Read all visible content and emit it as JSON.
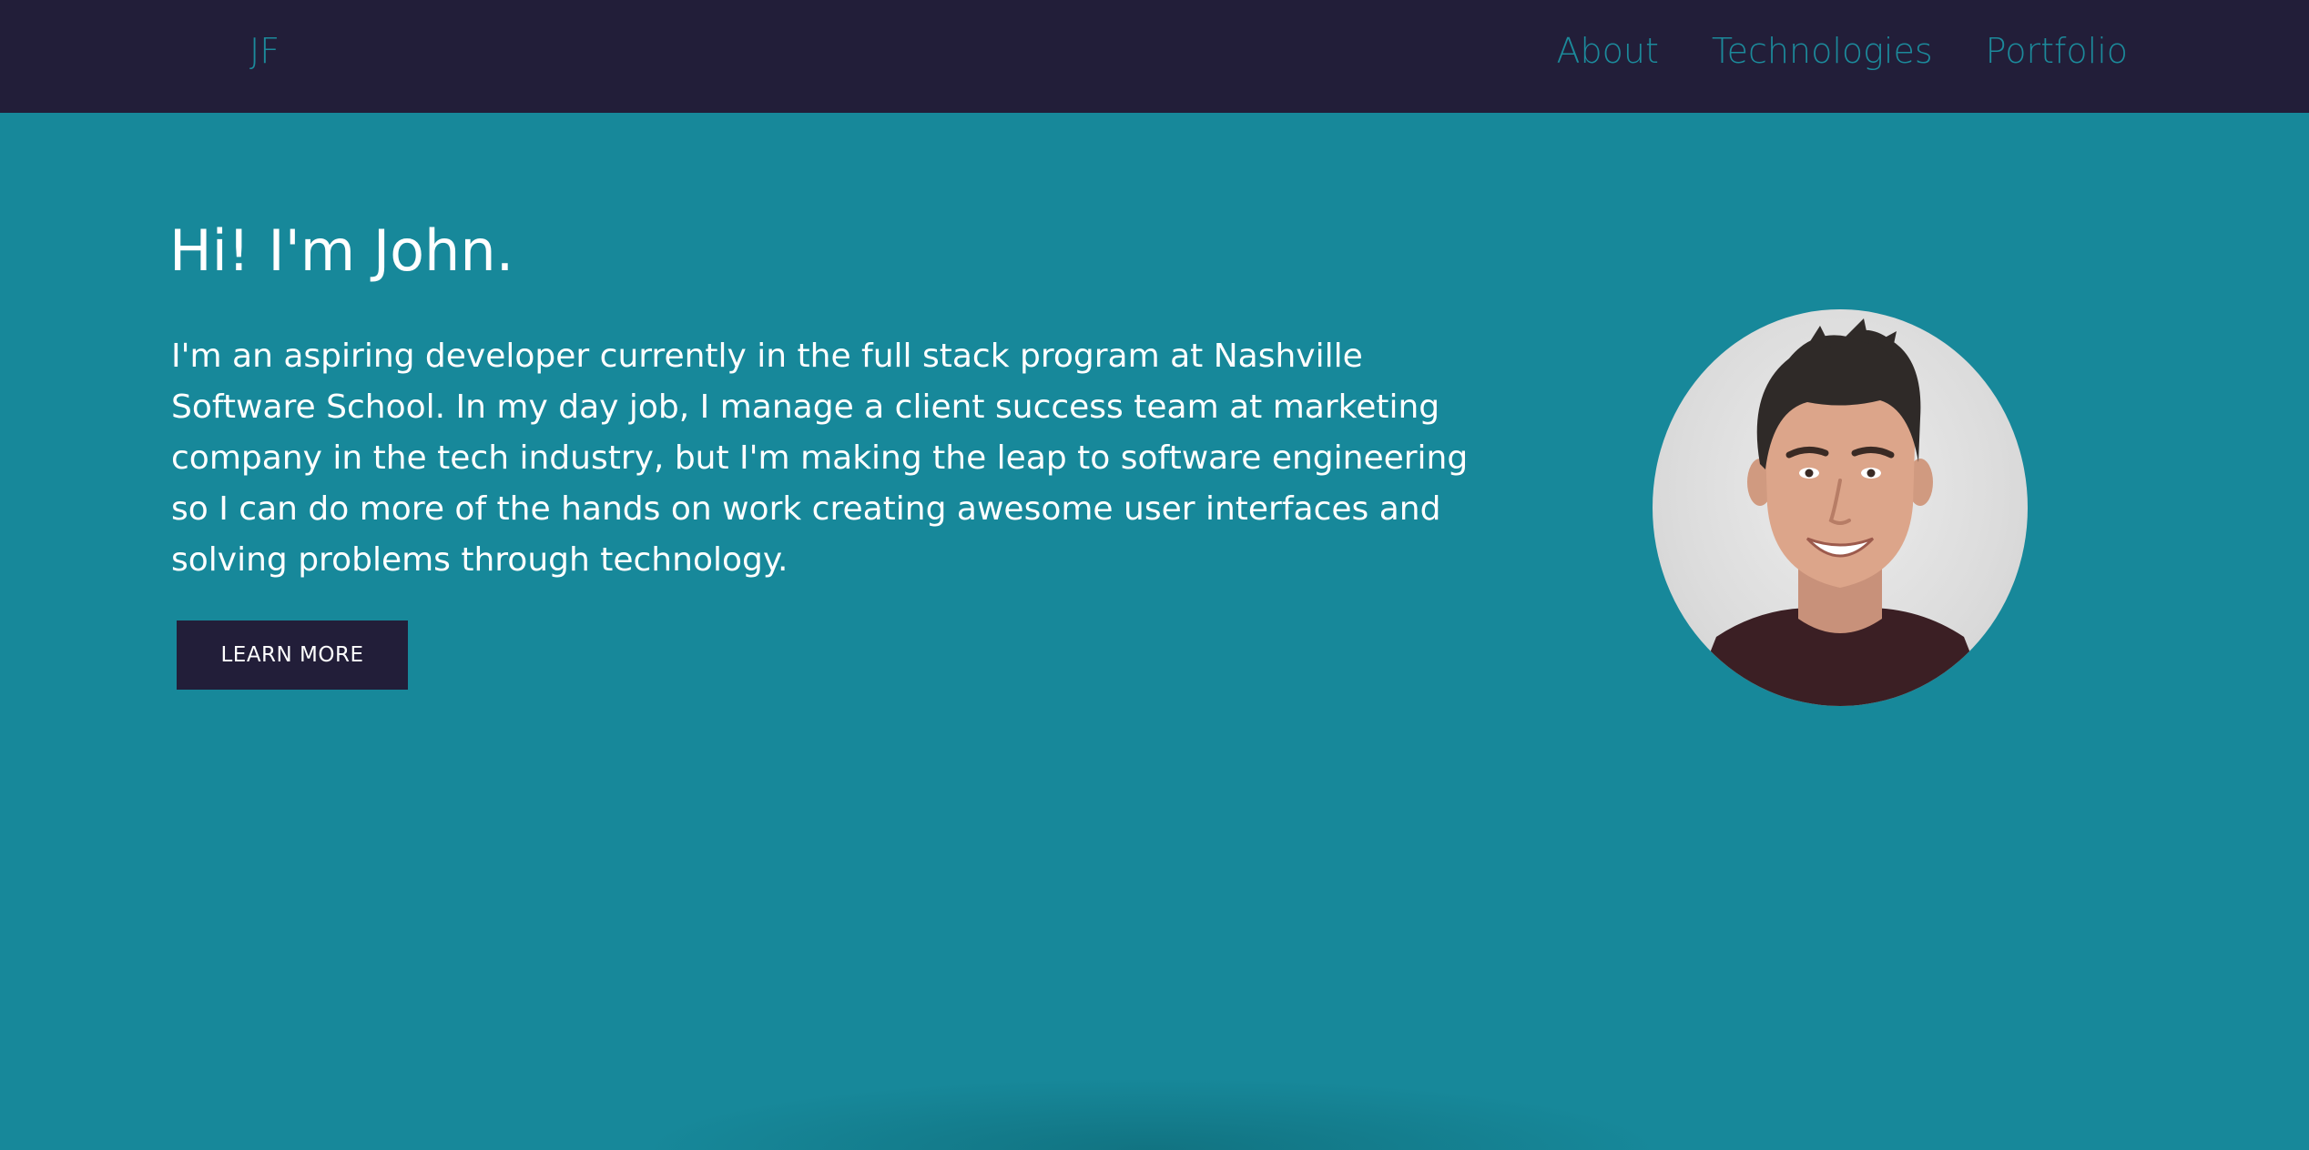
{
  "nav": {
    "brand": "JF",
    "links": [
      "About",
      "Technologies",
      "Portfolio"
    ]
  },
  "hero": {
    "title": "Hi! I'm John.",
    "intro": "I'm an aspiring developer currently in the full stack program at Nashville Software School. In my day job, I manage a client success team at marketing company in the tech industry, but I'm making the leap to software engineering so I can do more of the hands on work creating awesome user interfaces and solving problems through technology.",
    "button_label": "LEARN MORE"
  },
  "colors": {
    "nav_background": "#221e39",
    "page_background": "#17889a",
    "accent_text": "#1c8a9b",
    "button_background": "#221e39"
  }
}
